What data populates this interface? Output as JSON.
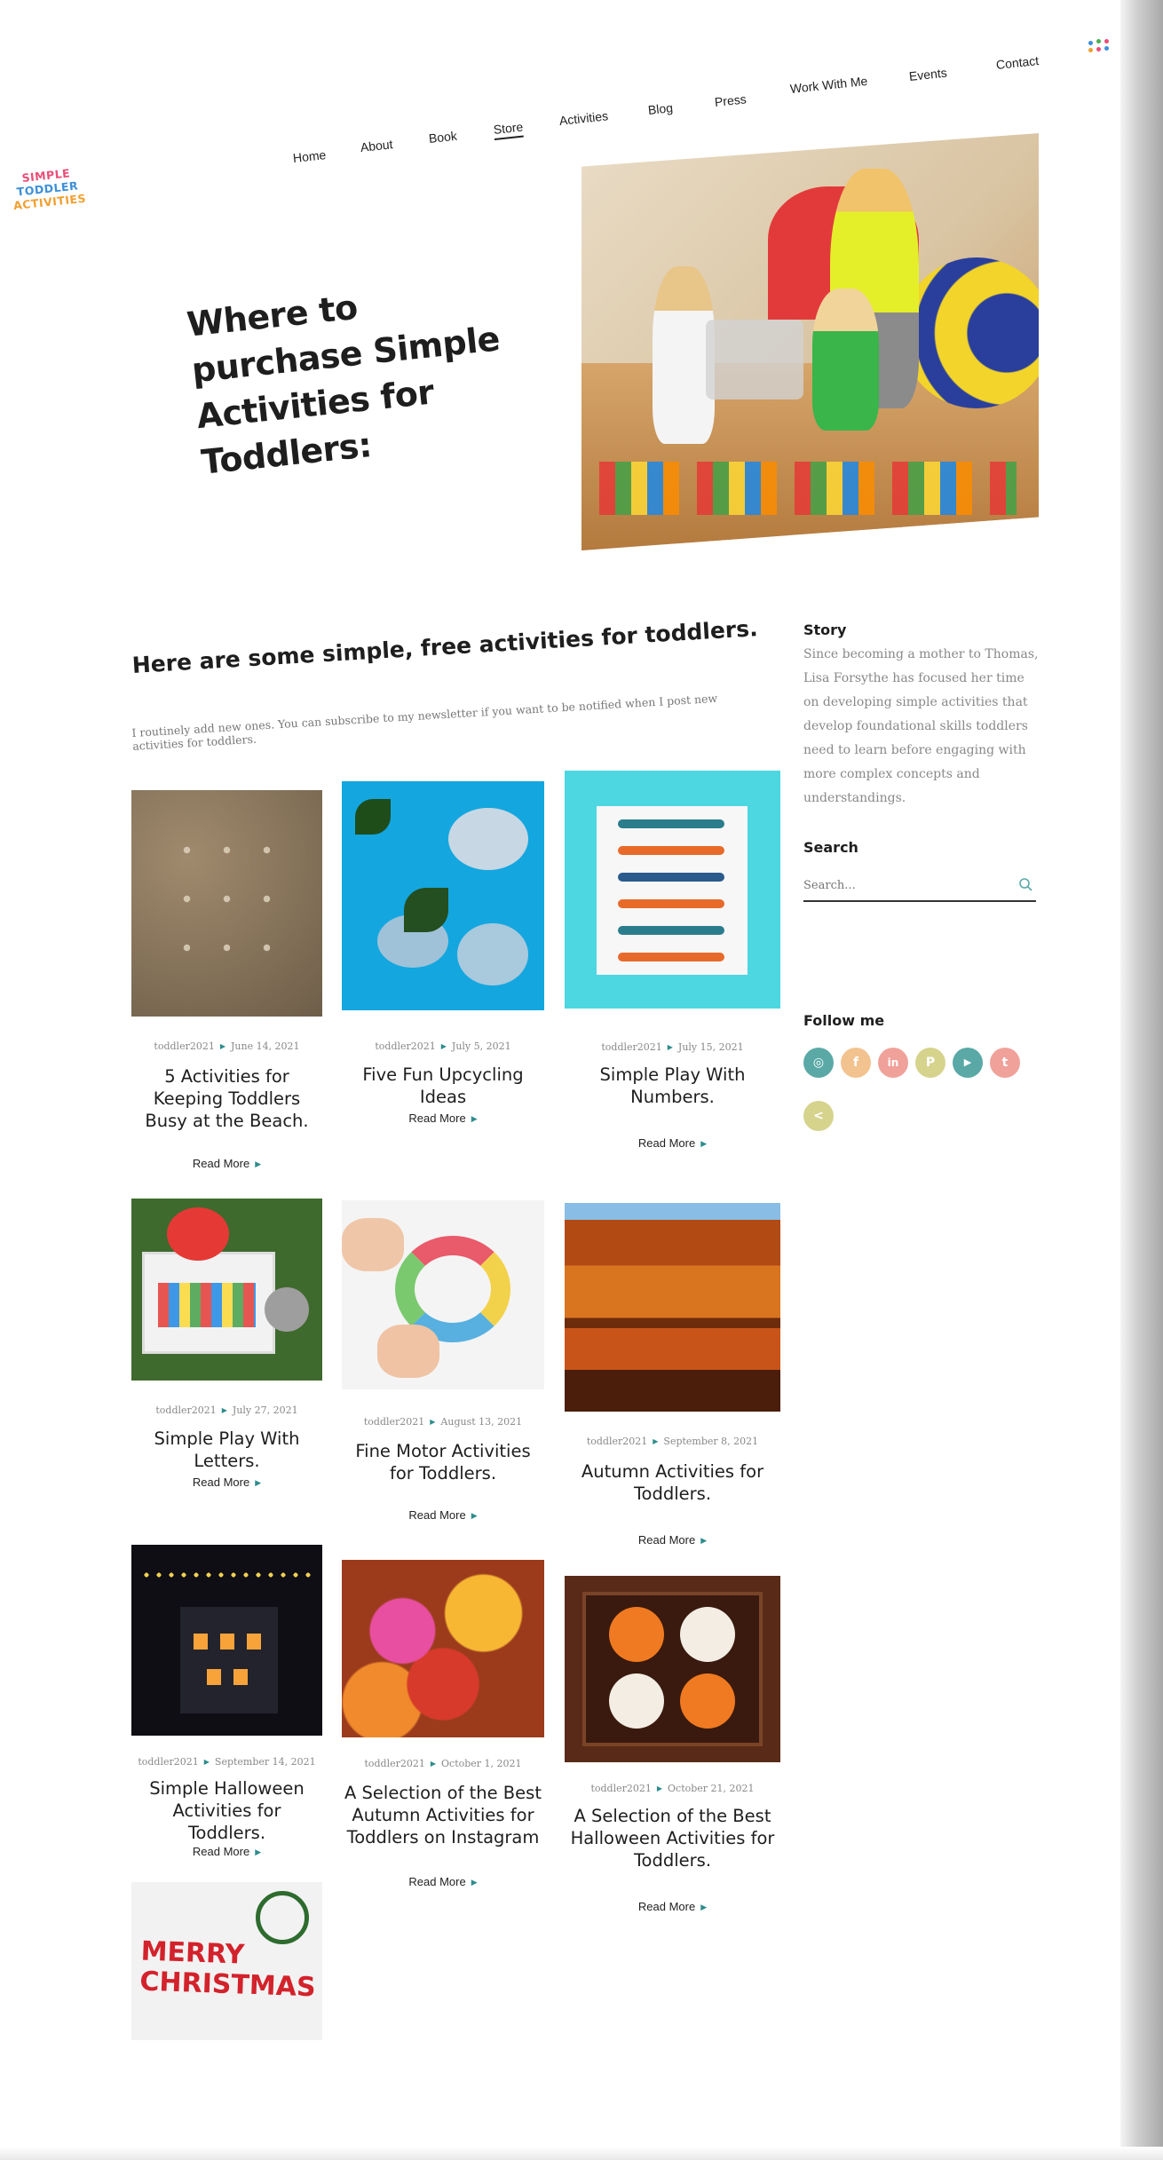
{
  "site": {
    "logo_lines": [
      "SIMPLE",
      "TODDLER",
      "ACTIVITIES"
    ]
  },
  "nav": {
    "items": [
      {
        "label": "Home"
      },
      {
        "label": "About"
      },
      {
        "label": "Book"
      },
      {
        "label": "Store",
        "active": true
      },
      {
        "label": "Activities"
      },
      {
        "label": "Blog"
      },
      {
        "label": "Press"
      },
      {
        "label": "Work With Me"
      },
      {
        "label": "Events"
      },
      {
        "label": "Contact"
      }
    ]
  },
  "hero": {
    "title": "Where to purchase Simple Activities for Toddlers:"
  },
  "intro": {
    "title": "Here are some simple, free activities for toddlers.",
    "text": "I routinely add new ones. You can subscribe to my newsletter if you want to be notified when I post new activities for toddlers."
  },
  "posts": [
    {
      "author": "toddler2021",
      "date": "June 14, 2021",
      "title": "5 Activities for Keeping Toddlers Busy at the Beach.",
      "more": "Read More",
      "image": "sand-footprints"
    },
    {
      "author": "toddler2021",
      "date": "July 5, 2021",
      "title": "Five Fun Upcycling Ideas",
      "more": "Read More",
      "image": "fish-craft"
    },
    {
      "author": "toddler2021",
      "date": "July 15, 2021",
      "title": "Simple Play With Numbers.",
      "more": "Read More",
      "image": "number-sticks"
    },
    {
      "author": "toddler2021",
      "date": "July 27, 2021",
      "title": "Simple Play With Letters.",
      "more": "Read More",
      "image": "letter-bin"
    },
    {
      "author": "toddler2021",
      "date": "August 13, 2021",
      "title": "Fine Motor Activities for Toddlers.",
      "more": "Read More",
      "image": "playdough-rainbow"
    },
    {
      "author": "toddler2021",
      "date": "September 8, 2021",
      "title": "Autumn Activities for Toddlers.",
      "more": "Read More",
      "image": "autumn-lake"
    },
    {
      "author": "toddler2021",
      "date": "September 14, 2021",
      "title": "Simple Halloween Activities for Toddlers.",
      "more": "Read More",
      "image": "haunted-house"
    },
    {
      "author": "toddler2021",
      "date": "October 1, 2021",
      "title": "A Selection of the Best Autumn Activities for Toddlers on Instagram",
      "more": "Read More",
      "image": "autumn-leaves"
    },
    {
      "author": "toddler2021",
      "date": "October 21, 2021",
      "title": "A Selection of the Best Halloween Activities for Toddlers.",
      "more": "Read More",
      "image": "pumpkin-cookies"
    },
    {
      "author": "",
      "date": "",
      "title": "",
      "more": "",
      "image": "merry-christmas",
      "image_text": "MERRY CHRISTMAS"
    }
  ],
  "sidebar": {
    "story_heading": "Story",
    "story_text": "Since becoming a mother to Thomas, Lisa Forsythe has focused her time on developing simple activities that develop foundational skills toddlers need to learn before engaging with more complex concepts and understandings.",
    "search_heading": "Search",
    "search_placeholder": "Search...",
    "follow_heading": "Follow me",
    "social": [
      {
        "icon": "instagram-icon",
        "glyph": "◎",
        "color": "#5aa9a6"
      },
      {
        "icon": "facebook-icon",
        "glyph": "f",
        "color": "#f2c38f"
      },
      {
        "icon": "linkedin-icon",
        "glyph": "in",
        "color": "#f0a19a"
      },
      {
        "icon": "pinterest-icon",
        "glyph": "P",
        "color": "#d6d38d"
      },
      {
        "icon": "youtube-icon",
        "glyph": "▶",
        "color": "#5aa9a6"
      },
      {
        "icon": "twitter-icon",
        "glyph": "t",
        "color": "#f0a19a"
      },
      {
        "icon": "share-icon",
        "glyph": "<",
        "color": "#d6d38d"
      }
    ]
  }
}
